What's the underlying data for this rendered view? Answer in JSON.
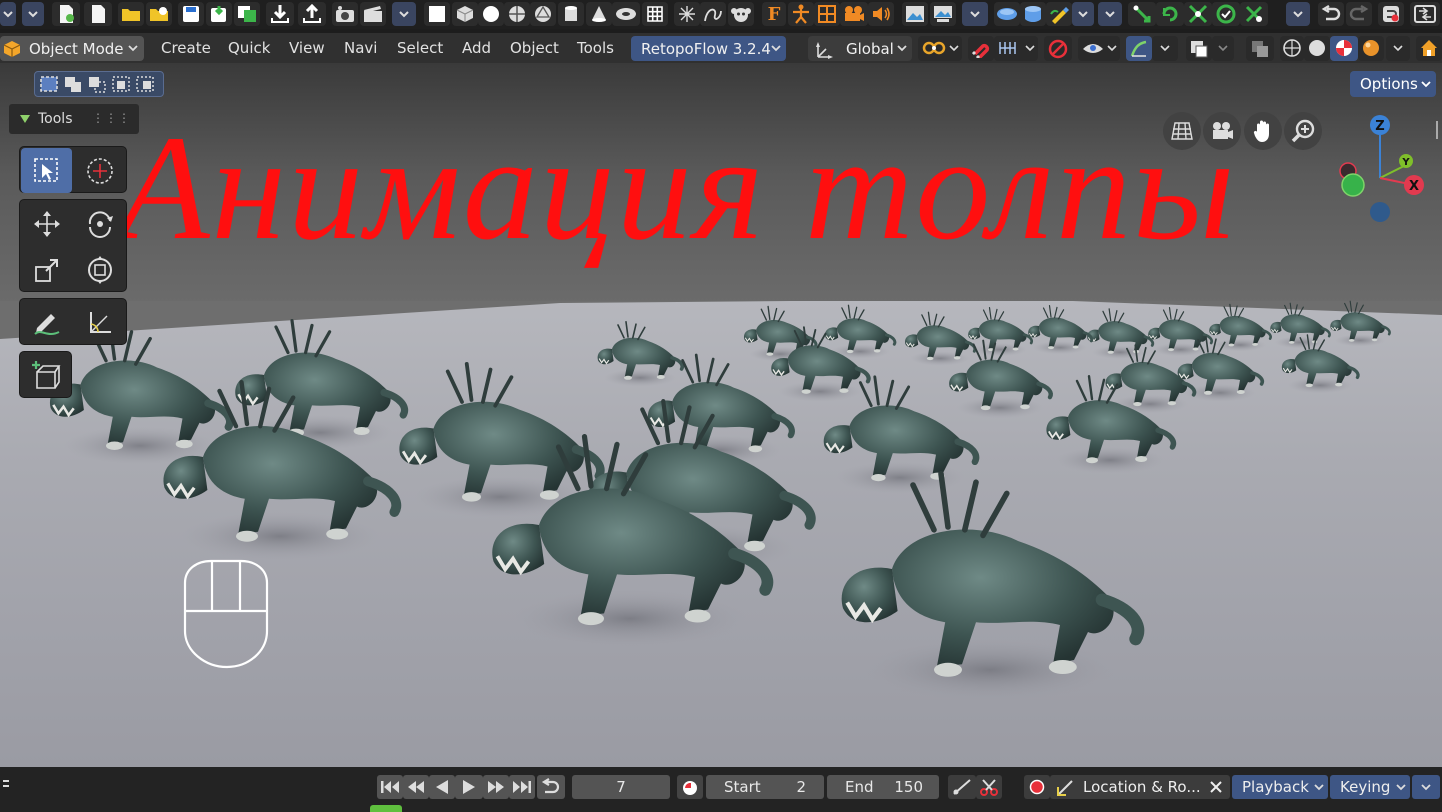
{
  "header": {
    "mode": "Object Mode",
    "menus": [
      "Create",
      "Quick",
      "View",
      "Navi",
      "Select",
      "Add",
      "Object",
      "Tools"
    ],
    "addon": "RetopoFlow 3.2.4",
    "orientation": "Global"
  },
  "viewport": {
    "options_label": "Options",
    "tools_label": "Tools",
    "overlay_text": "Анимация толпы",
    "gizmo": {
      "z_label": "Z",
      "y_label": "Y",
      "x_label": "X"
    }
  },
  "timeline": {
    "current_frame": "7",
    "start_label": "Start",
    "start_value": "2",
    "end_label": "End",
    "end_value": "150",
    "keying_set": "Location & Ro...",
    "playback_label": "Playback",
    "keying_label": "Keying"
  },
  "icons": {
    "toolbar": [
      "file-icon",
      "new-file-icon",
      "open-icon",
      "open-recent-icon",
      "save-icon",
      "save-as-icon",
      "save-copy-icon",
      "import-icon",
      "export-icon",
      "render-icon",
      "render-anim-icon",
      "plane-icon",
      "cube-icon",
      "sphere-icon",
      "uv-sphere-icon",
      "ico-sphere-icon",
      "cylinder-icon",
      "cone-icon",
      "torus-icon",
      "grid-icon",
      "empty-icon",
      "curve-icon",
      "monkey-icon",
      "text-icon",
      "armature-icon",
      "lattice-icon",
      "camera-icon",
      "speaker-icon",
      "image-icon",
      "image-empty-icon",
      "surface-icon",
      "meta-icon",
      "gpencil-icon",
      "constraint-icon",
      "rotate-constraint-icon",
      "scale-constraint-icon",
      "transform-constraint-icon",
      "track-constraint-icon",
      "undo-icon",
      "redo-icon",
      "undo-history-icon",
      "window-icon"
    ]
  },
  "colors": {
    "accent": "#4f6ea7",
    "overlay_text": "#ff0f0f",
    "gizmo_x": "#e23a4f",
    "gizmo_y": "#7fbf2a",
    "gizmo_z": "#3b82d6",
    "record": "#e8303a"
  }
}
